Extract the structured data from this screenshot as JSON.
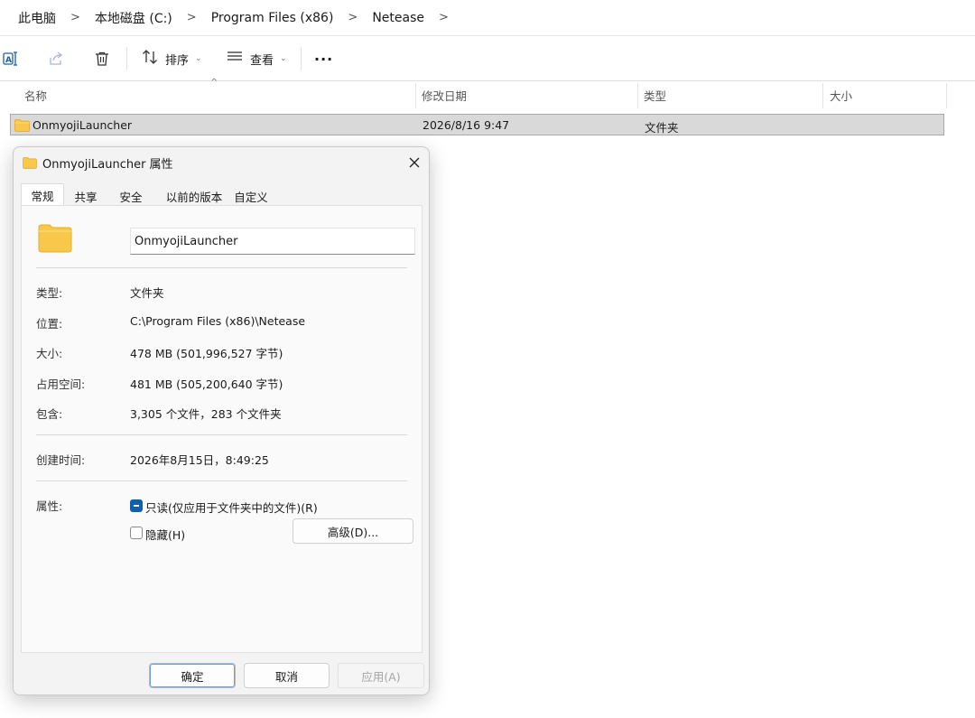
{
  "breadcrumb": {
    "items": [
      "此电脑",
      "本地磁盘 (C:)",
      "Program Files (x86)",
      "Netease"
    ],
    "separator": ">"
  },
  "toolbar": {
    "sort_label": "排序",
    "view_label": "查看",
    "more_label": "···"
  },
  "columns": {
    "name": "名称",
    "modified": "修改日期",
    "type": "类型",
    "size": "大小"
  },
  "file_row": {
    "name": "OnmyojiLauncher",
    "modified": "2026/8/16 9:47",
    "type": "文件夹",
    "size": ""
  },
  "dialog": {
    "title": "OnmyojiLauncher 属性",
    "tabs": [
      "常规",
      "共享",
      "安全",
      "以前的版本",
      "自定义"
    ],
    "active_tab": "常规",
    "folder_name": "OnmyojiLauncher",
    "props": {
      "type_label": "类型:",
      "type_value": "文件夹",
      "location_label": "位置:",
      "location_value": "C:\\Program Files (x86)\\Netease",
      "size_label": "大小:",
      "size_value": "478 MB (501,996,527 字节)",
      "disk_label": "占用空间:",
      "disk_value": "481 MB (505,200,640 字节)",
      "contains_label": "包含:",
      "contains_value": "3,305 个文件，283 个文件夹",
      "created_label": "创建时间:",
      "created_value": "2026年8月15日，8:49:25"
    },
    "attributes": {
      "label": "属性:",
      "readonly_label": "只读(仅应用于文件夹中的文件)(R)",
      "readonly_state": "indeterminate",
      "hidden_label": "隐藏(H)",
      "hidden_state": "unchecked",
      "advanced_label": "高级(D)..."
    },
    "buttons": {
      "ok": "确定",
      "cancel": "取消",
      "apply": "应用(A)"
    }
  },
  "colors": {
    "selection_bg": "#d9d9d9",
    "folder_yellow": "#f8c84a",
    "checkbox_blue": "#0f5fb5"
  }
}
